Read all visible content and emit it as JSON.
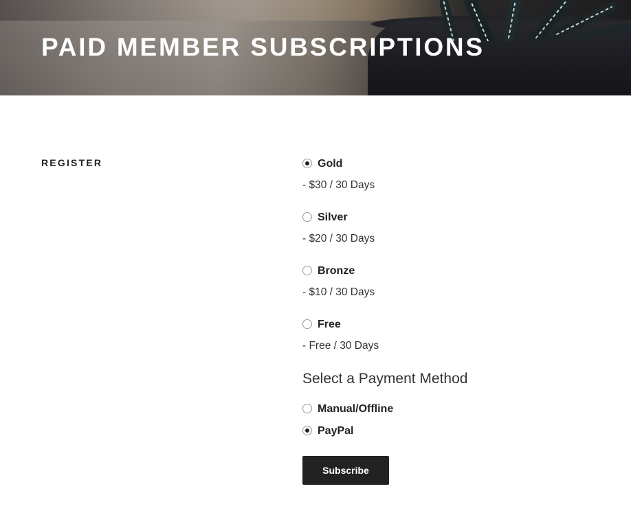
{
  "header": {
    "title": "PAID MEMBER SUBSCRIPTIONS"
  },
  "form": {
    "section_label": "REGISTER",
    "plans": [
      {
        "name": "Gold",
        "price": "- $30 / 30 Days",
        "selected": true
      },
      {
        "name": "Silver",
        "price": "- $20 / 30 Days",
        "selected": false
      },
      {
        "name": "Bronze",
        "price": "- $10 / 30 Days",
        "selected": false
      },
      {
        "name": "Free",
        "price": "- Free / 30 Days",
        "selected": false
      }
    ],
    "payment": {
      "heading": "Select a Payment Method",
      "options": [
        {
          "label": "Manual/Offline",
          "selected": false
        },
        {
          "label": "PayPal",
          "selected": true
        }
      ]
    },
    "submit_label": "Subscribe"
  },
  "colors": {
    "text": "#222222",
    "button_bg": "#222222",
    "button_text": "#ffffff"
  }
}
